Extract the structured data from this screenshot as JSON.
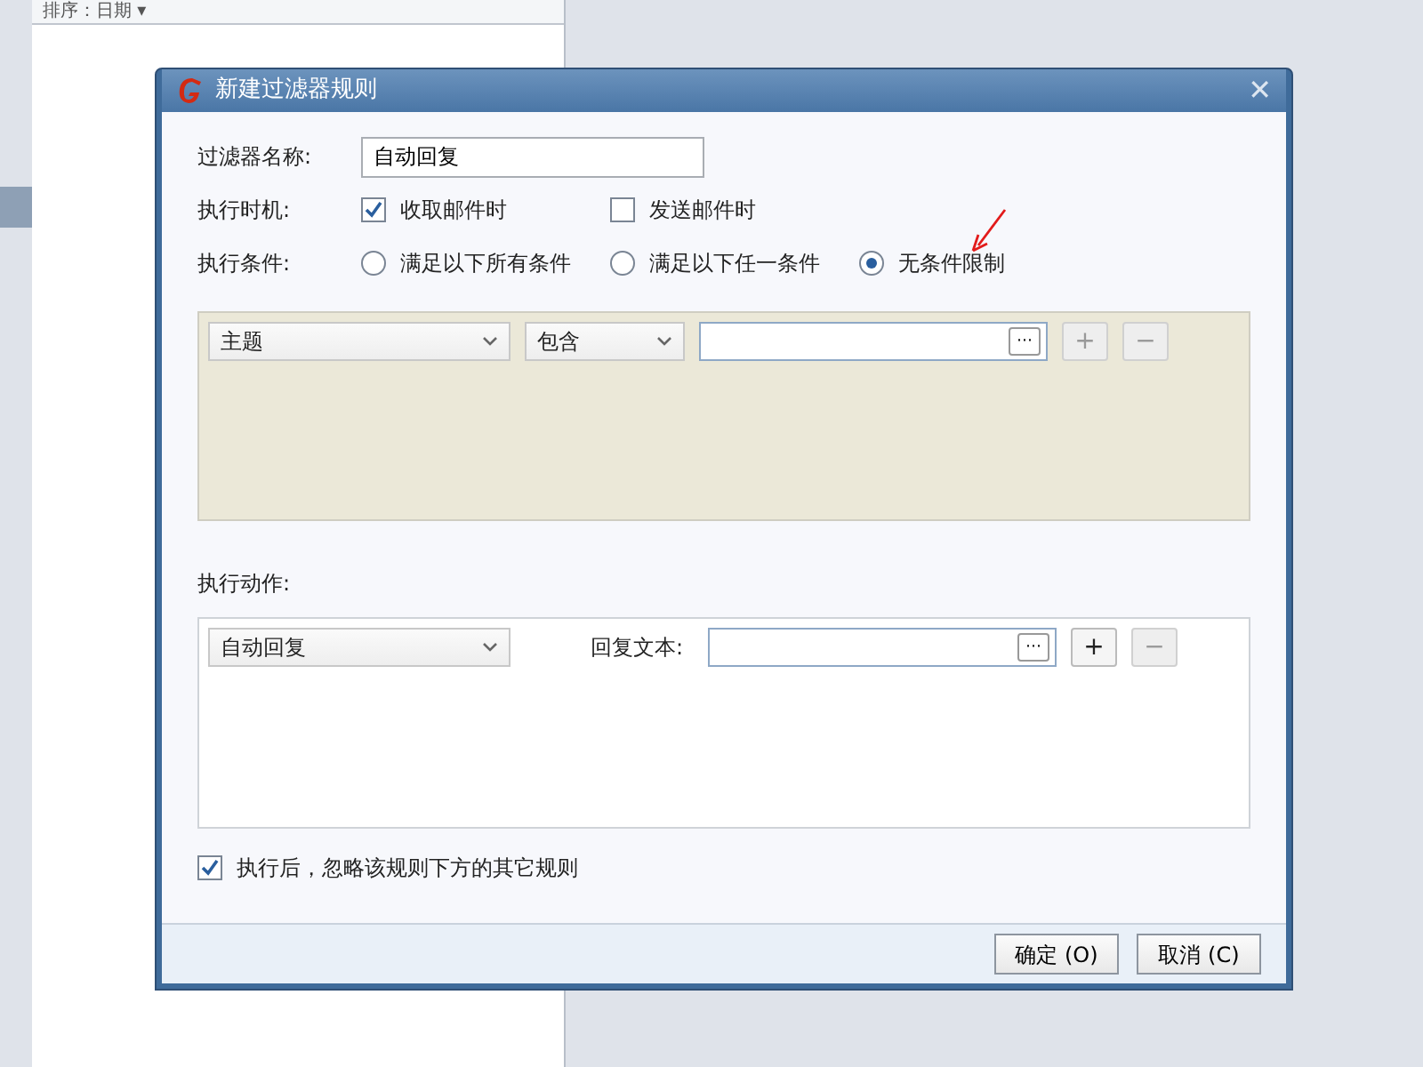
{
  "background": {
    "sort_label": "排序：日期 ▾"
  },
  "dialog": {
    "title": "新建过滤器规则",
    "close": "✕",
    "name_field": {
      "label": "过滤器名称:",
      "value": "自动回复"
    },
    "timing": {
      "label": "执行时机:",
      "options": [
        {
          "label": "收取邮件时",
          "checked": true
        },
        {
          "label": "发送邮件时",
          "checked": false
        }
      ]
    },
    "condition": {
      "label": "执行条件:",
      "options": [
        {
          "label": "满足以下所有条件",
          "selected": false
        },
        {
          "label": "满足以下任一条件",
          "selected": false
        },
        {
          "label": "无条件限制",
          "selected": true
        }
      ]
    },
    "condition_rows": [
      {
        "field": "主题",
        "operator": "包含",
        "more": "⋯",
        "add": {
          "label": "+",
          "disabled": true
        },
        "remove": {
          "label": "−",
          "disabled": true
        }
      }
    ],
    "action_label": "执行动作:",
    "action_rows": [
      {
        "action": "自动回复",
        "text_label": "回复文本:",
        "more": "⋯",
        "add": {
          "label": "+",
          "disabled": false
        },
        "remove": {
          "label": "−",
          "disabled": true
        }
      }
    ],
    "stop_option": {
      "label": "执行后，忽略该规则下方的其它规则",
      "checked": true
    },
    "buttons": [
      {
        "label": "确定 (O)"
      },
      {
        "label": "取消 (C)"
      }
    ]
  }
}
